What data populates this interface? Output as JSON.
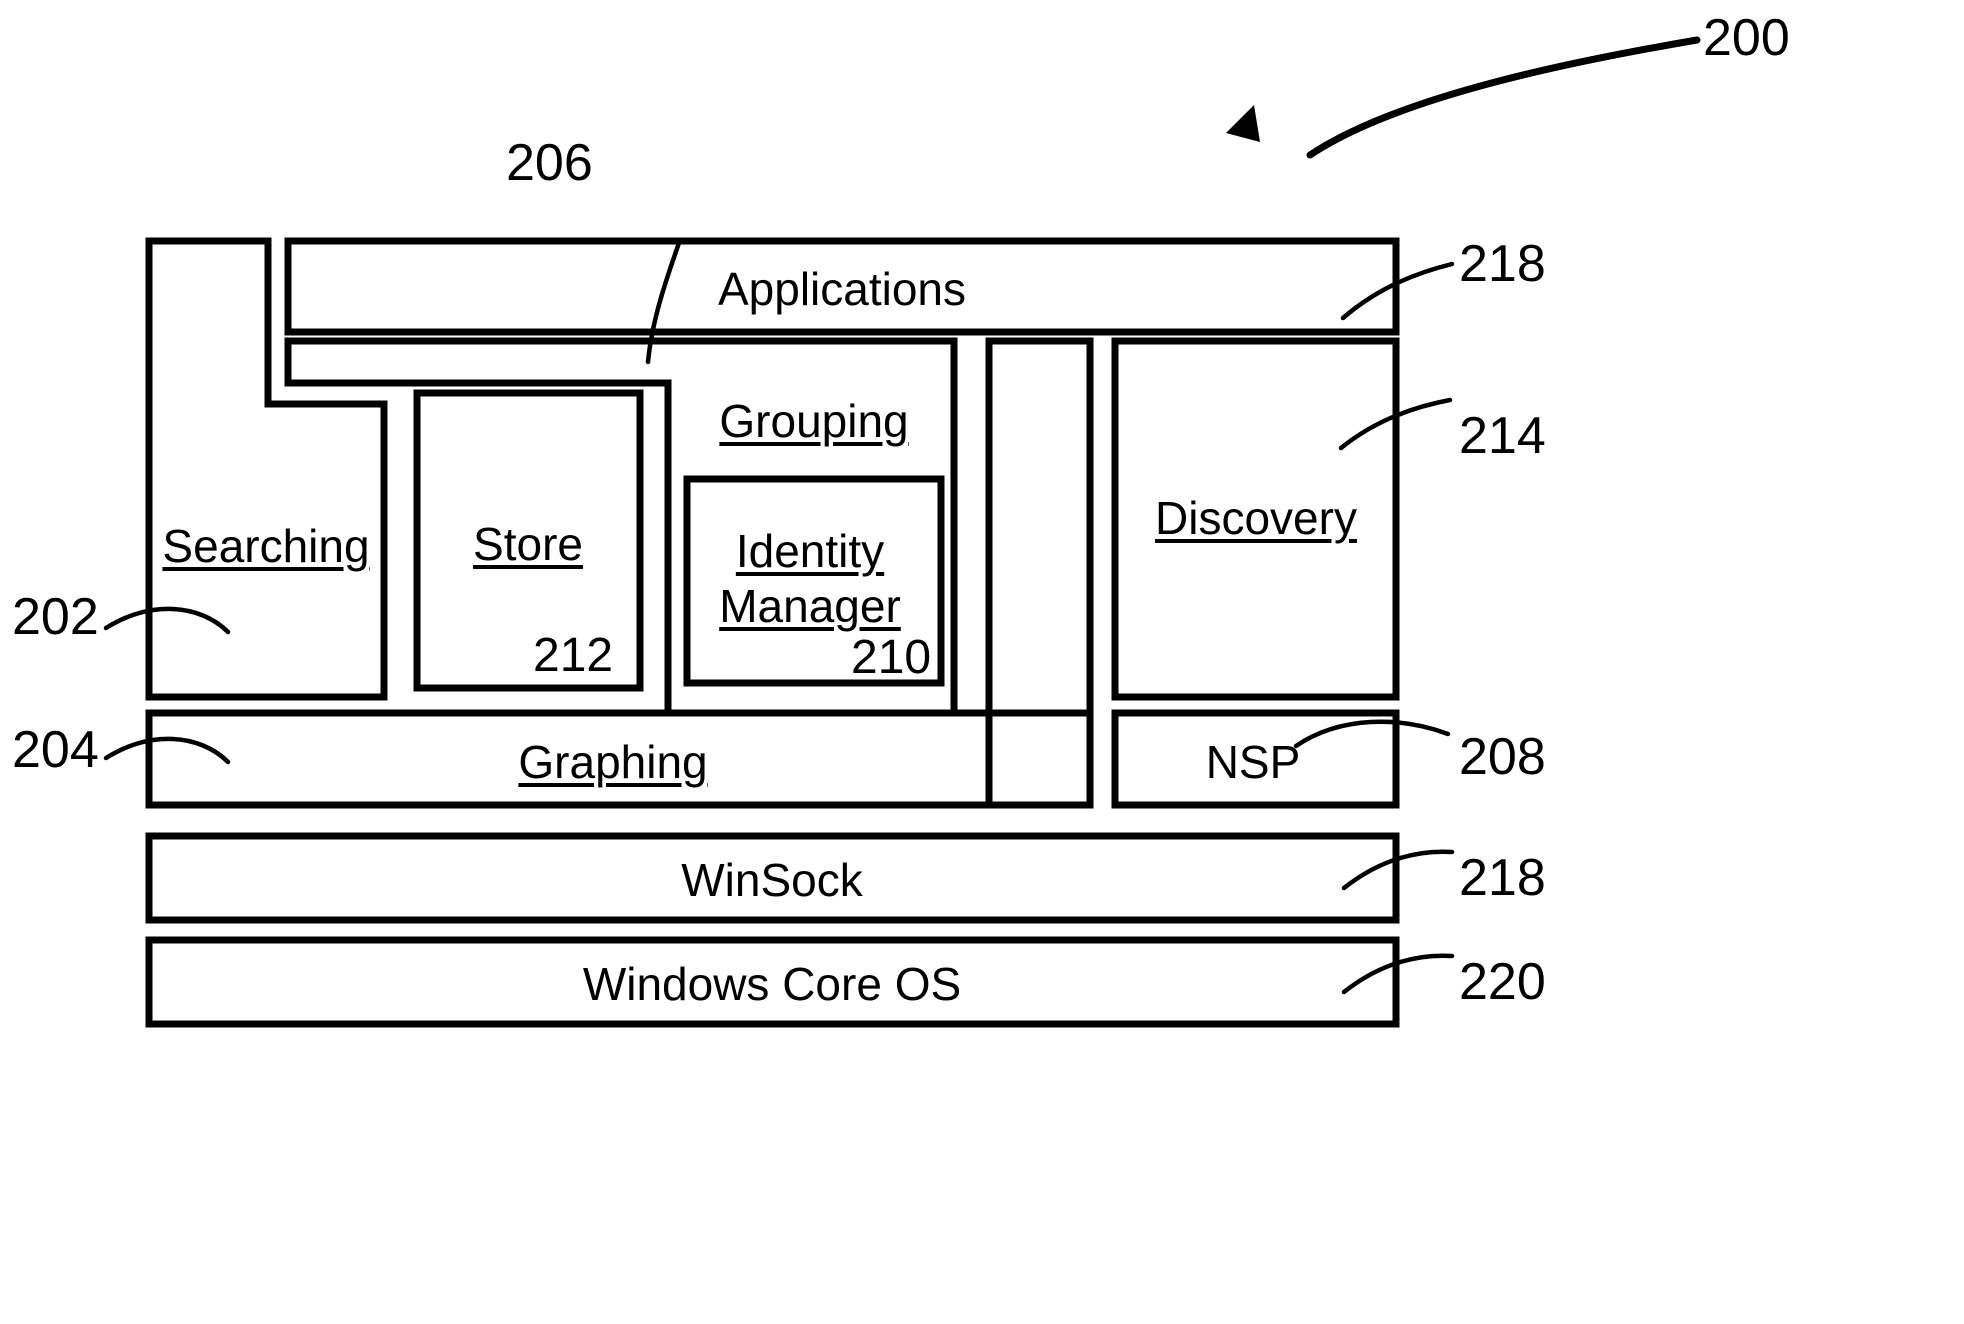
{
  "figure": {
    "reference": "200",
    "type": "patent-architecture-diagram"
  },
  "blocks": {
    "applications": {
      "label": "Applications",
      "ref": "218",
      "underlined": false
    },
    "searching": {
      "label": "Searching",
      "ref": "202",
      "underlined": true
    },
    "store": {
      "label": "Store",
      "ref": "212",
      "underlined": true
    },
    "grouping": {
      "label": "Grouping",
      "ref": "206",
      "underlined": true
    },
    "identity_manager": {
      "label_line1": "Identity",
      "label_line2": "Manager",
      "ref": "210",
      "underlined": true
    },
    "discovery": {
      "label": "Discovery",
      "ref": "214",
      "underlined": true
    },
    "graphing": {
      "label": "Graphing",
      "ref": "204",
      "underlined": true
    },
    "nsp": {
      "label": "NSP",
      "ref": "208",
      "underlined": false
    },
    "winsock": {
      "label": "WinSock",
      "ref": "218",
      "underlined": false
    },
    "windows_core_os": {
      "label": "Windows Core OS",
      "ref": "220",
      "underlined": false
    }
  },
  "reference_numerals": {
    "fig": "200",
    "searching": "202",
    "graphing": "204",
    "grouping": "206",
    "nsp": "208",
    "identity_manager": "210",
    "store": "212",
    "discovery": "214",
    "applications": "218",
    "winsock": "218",
    "windows_core_os": "220"
  },
  "colors": {
    "stroke": "#000000",
    "fill": "#ffffff",
    "text": "#000000"
  }
}
